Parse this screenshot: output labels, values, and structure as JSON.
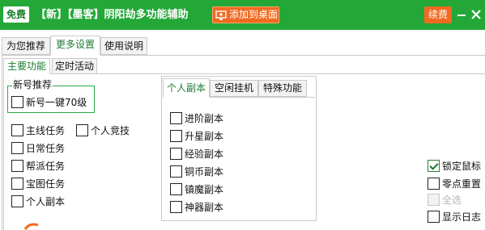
{
  "titlebar": {
    "badge": "免费",
    "title": "【新】【墨客】阴阳劫多功能辅助",
    "add_to_desktop": "添加到桌面",
    "renew": "续费",
    "colors": {
      "bar": "#23a838",
      "accent": "#f26a21"
    }
  },
  "top_tabs": [
    "为您推荐",
    "更多设置",
    "使用说明"
  ],
  "sub_tabs": [
    "主要功能",
    "定时活动"
  ],
  "new_account": {
    "group_title": "新号推荐",
    "one_click": "新号一键70级"
  },
  "tasks": {
    "main": "主线任务",
    "daily": "日常任务",
    "guild": "帮派任务",
    "treasure": "宝图任务",
    "personal_dungeon": "个人副本",
    "arena": "个人竞技"
  },
  "dungeon_tabs": [
    "个人副本",
    "空闲挂机",
    "特殊功能"
  ],
  "dungeons": [
    "进阶副本",
    "升星副本",
    "经验副本",
    "铜币副本",
    "镇魔副本",
    "神器副本"
  ],
  "right_options": {
    "lock_mouse": "锁定鼠标",
    "reset_zero": "零点重置",
    "select_all": "全选",
    "show_log": "显示日志"
  },
  "states": {
    "lock_mouse_checked": true,
    "select_all_disabled": true
  },
  "icons": [
    "desktop-add-icon",
    "minimize-icon",
    "close-icon",
    "logo-fragment-icon"
  ]
}
